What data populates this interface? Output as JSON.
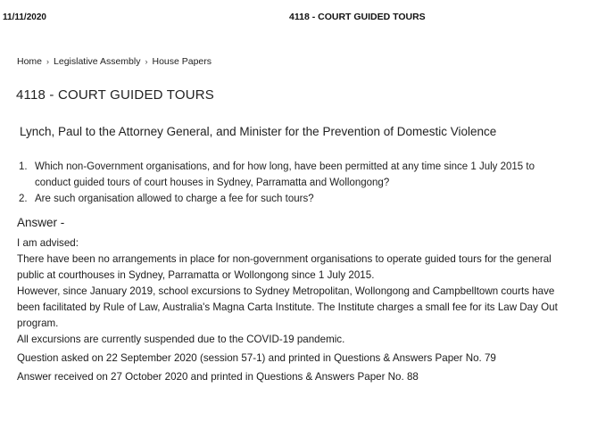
{
  "header": {
    "date": "11/11/2020",
    "title": "4118 - COURT GUIDED TOURS"
  },
  "breadcrumb": {
    "items": [
      "Home",
      "Legislative Assembly",
      "House Papers"
    ],
    "separator": "›"
  },
  "page_title": "4118 - COURT GUIDED TOURS",
  "asker": "Lynch, Paul to the Attorney General, and Minister for the Prevention of Domestic Violence",
  "questions": [
    {
      "num": "1.",
      "text": "Which non-Government organisations, and for how long, have been permitted at any time since 1 July 2015 to conduct guided tours of court houses in Sydney, Parramatta and Wollongong?"
    },
    {
      "num": "2.",
      "text": "Are such organisation allowed to charge a fee for such tours?"
    }
  ],
  "answer": {
    "heading": "Answer -",
    "lines": [
      "I am advised:",
      "There have been no arrangements in place for non-government organisations to operate guided tours for the general public at courthouses in Sydney, Parramatta or Wollongong since 1 July 2015.",
      "However, since January 2019, school excursions to Sydney Metropolitan, Wollongong and Campbelltown courts have been facilitated by Rule of Law, Australia's Magna Carta Institute. The Institute charges a small fee for its Law Day Out program.",
      "All excursions are currently suspended due to the COVID-19 pandemic."
    ],
    "asked": "Question asked on 22 September 2020 (session 57-1) and printed in Questions & Answers Paper No. 79",
    "received": "Answer received on 27 October 2020 and printed in Questions & Answers Paper No. 88"
  }
}
